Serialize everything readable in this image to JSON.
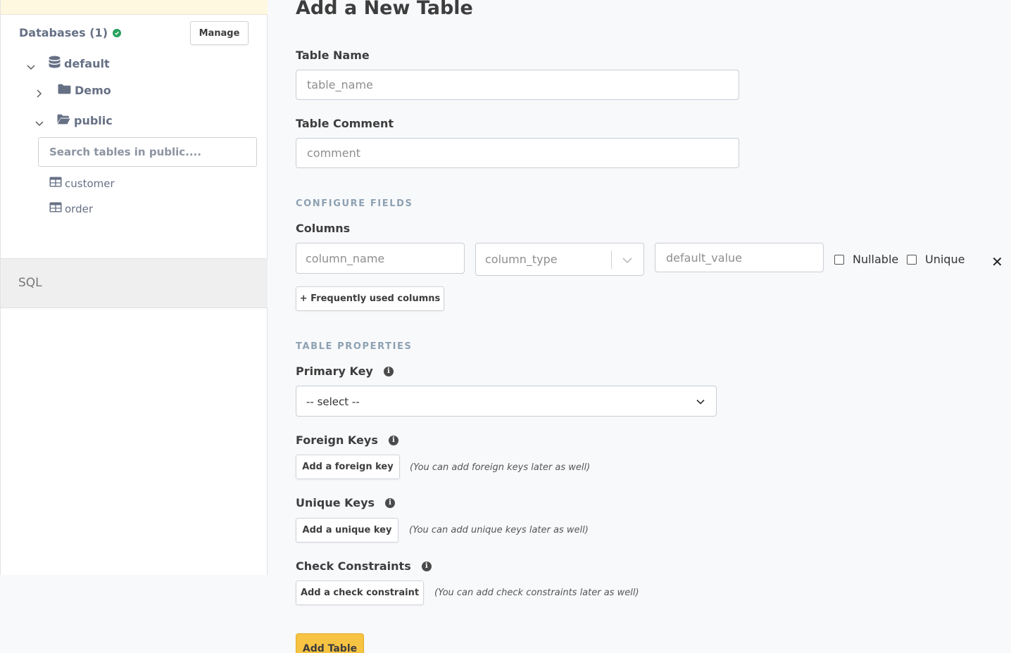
{
  "sidebar": {
    "databases_label": "Databases (1)",
    "manage_label": "Manage",
    "tree": {
      "default": "default",
      "demo": "Demo",
      "public": "public"
    },
    "search_placeholder": "Search tables in public....",
    "tables": [
      "customer",
      "order"
    ],
    "sql_label": "SQL"
  },
  "main": {
    "title": "Add a New Table",
    "table_name_label": "Table Name",
    "table_name_placeholder": "table_name",
    "table_comment_label": "Table Comment",
    "table_comment_placeholder": "comment",
    "configure_fields_heading": "CONFIGURE FIELDS",
    "columns_label": "Columns",
    "column_name_placeholder": "column_name",
    "column_type_placeholder": "column_type",
    "default_value_placeholder": "default_value",
    "nullable_label": "Nullable",
    "unique_label": "Unique",
    "frequently_used_label": "+ Frequently used columns",
    "table_properties_heading": "TABLE PROPERTIES",
    "primary_key_label": "Primary Key",
    "primary_key_value": "-- select --",
    "foreign_keys_label": "Foreign Keys",
    "add_foreign_key_label": "Add a foreign key",
    "foreign_keys_hint": "(You can add foreign keys later as well)",
    "unique_keys_label": "Unique Keys",
    "add_unique_key_label": "Add a unique key",
    "unique_keys_hint": "(You can add unique keys later as well)",
    "check_constraints_label": "Check Constraints",
    "add_check_constraint_label": "Add a check constraint",
    "check_constraints_hint": "(You can add check constraints later as well)",
    "add_table_label": "Add Table"
  },
  "icons": {
    "status": "check-circle-icon",
    "database": "database-icon",
    "folder": "folder-icon",
    "folder_open": "folder-open-icon",
    "table": "table-icon",
    "info": "info-icon",
    "remove": "close-icon"
  },
  "colors": {
    "accent_button": "#f6c343",
    "status_ok": "#27a15d",
    "section_heading": "#8ea1b2"
  }
}
